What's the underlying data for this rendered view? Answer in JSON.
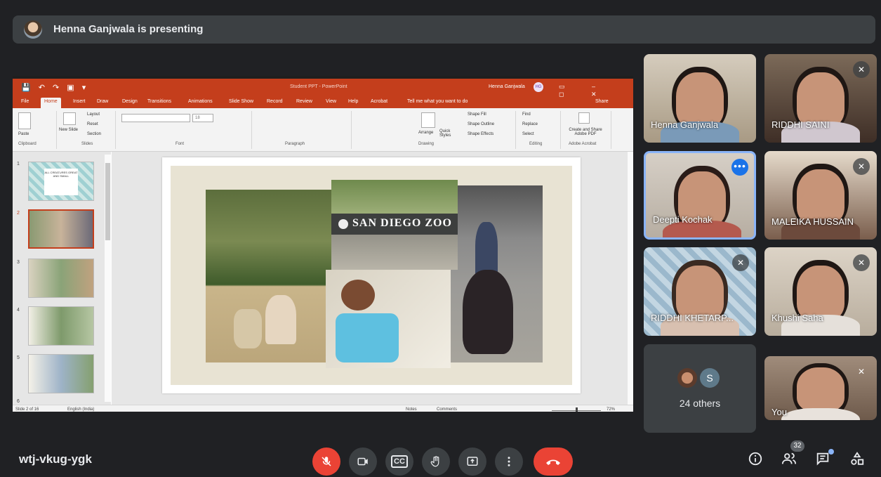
{
  "presenting_bar": {
    "text": "Henna Ganjwala is presenting"
  },
  "powerpoint": {
    "quick_access": "💾 ↶ ↷ ▣ ▾",
    "window_title": "Student PPT - PowerPoint",
    "user_name": "Henna Ganjwala",
    "user_initials": "HG",
    "window_controls": "▭ – ◻ ✕",
    "tabs": [
      "File",
      "Home",
      "Insert",
      "Draw",
      "Design",
      "Transitions",
      "Animations",
      "Slide Show",
      "Record",
      "Review",
      "View",
      "Help",
      "Acrobat"
    ],
    "tell_me": "Tell me what you want to do",
    "share": "Share",
    "ribbon": {
      "paste": "Paste",
      "new_slide": "New Slide",
      "layout": "Layout",
      "reset": "Reset",
      "section": "Section",
      "font_size": "18",
      "find": "Find",
      "replace": "Replace",
      "select": "Select",
      "create_share_pdf": "Create and Share Adobe PDF",
      "arrange": "Arrange",
      "quick_styles": "Quick Styles",
      "shape_fill": "Shape Fill",
      "shape_outline": "Shape Outline",
      "shape_effects": "Shape Effects",
      "groups": [
        "Clipboard",
        "Slides",
        "Font",
        "Paragraph",
        "Drawing",
        "Editing",
        "Adobe Acrobat"
      ]
    },
    "thumbnails": [
      {
        "num": "1",
        "text": "ALL CREATURES GREAT AND SMALL"
      },
      {
        "num": "2"
      },
      {
        "num": "3"
      },
      {
        "num": "4"
      },
      {
        "num": "5"
      },
      {
        "num": "6"
      }
    ],
    "slide": {
      "sign_text": "SAN DIEGO ZOO"
    },
    "status": {
      "slide_of": "Slide 2 of 16",
      "language": "English (India)",
      "notes": "Notes",
      "comments": "Comments",
      "zoom": "72%"
    }
  },
  "participants": [
    {
      "name": "Henna Ganjwala",
      "muted": false
    },
    {
      "name": "RIDDHI SAINI",
      "muted": true
    },
    {
      "name": "Deepti Kochak",
      "muted": false,
      "active": true
    },
    {
      "name": "MALEIKA HUSSAIN",
      "muted": true
    },
    {
      "name": "RIDDHI KHETARP...",
      "muted": true
    },
    {
      "name": "Khushi Saha",
      "muted": true
    },
    {
      "name": "You",
      "muted": true
    }
  ],
  "others": {
    "count_label": "24 others",
    "avatar_letter": "S"
  },
  "meeting_code": "wtj-vkug-ygk",
  "controls": {
    "mic": "mic-off-icon",
    "camera": "camera-icon",
    "captions_label": "CC",
    "raise_hand": "hand-icon",
    "present": "present-icon",
    "more": "more-icon",
    "end_call": "end-call-icon"
  },
  "right_controls": {
    "people_count": "32"
  },
  "colors": {
    "ppt_accent": "#c43e1c",
    "meet_bg": "#202124",
    "end_red": "#ea4335",
    "active_border": "#8ab4f8"
  }
}
